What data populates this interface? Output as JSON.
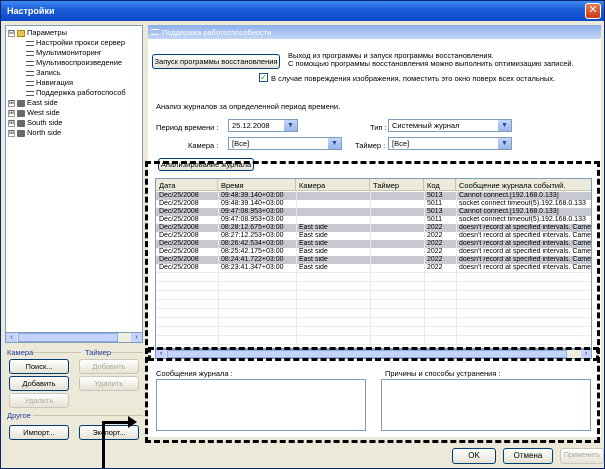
{
  "window": {
    "title": "Настройки",
    "close_glyph": "✕"
  },
  "tree": {
    "items": [
      {
        "label": "Параметры",
        "icon": "wrench-icon",
        "expander": "⊟"
      },
      {
        "label": "Настройки прокси сервер",
        "icon": "list-icon"
      },
      {
        "label": "Мультимониторинг",
        "icon": "list-icon"
      },
      {
        "label": "Мультивоспроизведение",
        "icon": "list-icon"
      },
      {
        "label": "Запись",
        "icon": "list-icon"
      },
      {
        "label": "Навигация",
        "icon": "list-icon"
      },
      {
        "label": "Поддержка работоспособ",
        "icon": "list-icon",
        "selected": true
      },
      {
        "label": "East side",
        "icon": "camera-icon",
        "expander": "⊞"
      },
      {
        "label": "West side",
        "icon": "camera-icon",
        "expander": "⊞"
      },
      {
        "label": "South side",
        "icon": "camera-icon",
        "expander": "⊞"
      },
      {
        "label": "North side",
        "icon": "camera-icon",
        "expander": "⊞"
      }
    ]
  },
  "left_groups": {
    "camera_label": "Камера",
    "timer_label": "Таймер",
    "search_btn": "Поиск...",
    "add_btn_1": "Добавить",
    "add_btn_2": "Добавить",
    "delete_btn_1": "Удалить",
    "delete_btn_2": "Удалить",
    "other_label": "Другое",
    "import_btn": "Импорт...",
    "export_btn": "Экспорт..."
  },
  "panel": {
    "header": "Поддержка работоспособности",
    "restore_btn": "Запуск программы восстановления",
    "restore_desc_1": "Выход из программы и запуск программы восстановления.",
    "restore_desc_2": "С помощью программы восстановления можно выполнить оптимизацию записей.",
    "checkbox_label": "В случае повреждения изображения, поместить это окно поверх всех остальных.",
    "checkbox_checked": true,
    "analysis_title": "Анализ журналов за определенной период времени.",
    "period_label": "Период времени :",
    "period_value": "25.12.2008",
    "type_label": "Тип :",
    "type_value": "Системный журнал",
    "camera_label": "Камера :",
    "camera_value": "[Все]",
    "timer_label": "Таймер :",
    "timer_value": "[Все]",
    "analyze_btn": "Анализирование журнала",
    "log_messages_label": "Сообщения журнала :",
    "causes_label": "Причины и способы устранения :"
  },
  "table": {
    "columns": [
      "Дата",
      "Время",
      "Камера",
      "Таймер",
      "Код",
      "Сообщение журнала событий."
    ],
    "rows": [
      [
        "Dec/25/2008",
        "09:48:39.140+03:00",
        "",
        "",
        "5013",
        "Cannot connect.[192.168.0.133]"
      ],
      [
        "Dec/25/2008",
        "09:48:39.140+03:00",
        "",
        "",
        "5011",
        "socket connect timeout(5).192.168.0.133"
      ],
      [
        "Dec/25/2008",
        "09:47:08.953+03:00",
        "",
        "",
        "5013",
        "Cannot connect.[192.168.0.133]"
      ],
      [
        "Dec/25/2008",
        "09:47:08.953+03:00",
        "",
        "",
        "5011",
        "socket connect timeout(5).192.168.0.133"
      ],
      [
        "Dec/25/2008",
        "08:28:12.675+03:00",
        "East side",
        "",
        "2022",
        "doesn't record at specified intervals. Came"
      ],
      [
        "Dec/25/2008",
        "08:27:12.253+03:00",
        "East side",
        "",
        "2022",
        "doesn't record at specified intervals. Came"
      ],
      [
        "Dec/25/2008",
        "08:26:42.534+03:00",
        "East side",
        "",
        "2022",
        "doesn't record at specified intervals. Came"
      ],
      [
        "Dec/25/2008",
        "08:25:42.175+03:00",
        "East side",
        "",
        "2022",
        "doesn't record at specified intervals. Came"
      ],
      [
        "Dec/25/2008",
        "08:24:41.722+03:00",
        "East side",
        "",
        "2022",
        "doesn't record at specified intervals. Came"
      ],
      [
        "Dec/25/2008",
        "08:23:41.347+03:00",
        "East side",
        "",
        "2022",
        "doesn't record at specified intervals. Came"
      ]
    ]
  },
  "footer": {
    "ok": "OK",
    "cancel": "Отмена",
    "apply": "Применить"
  }
}
